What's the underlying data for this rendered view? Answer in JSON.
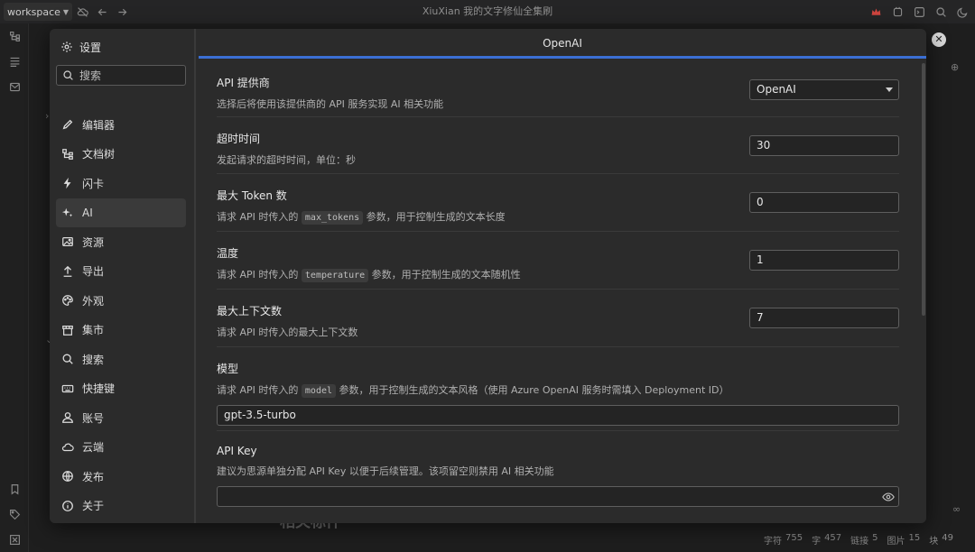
{
  "topbar": {
    "workspace_label": "workspace",
    "title": "XiuXian 我的文字修仙全集刷"
  },
  "background": {
    "heading": "相关标件",
    "status": [
      {
        "label": "字符",
        "value": "755"
      },
      {
        "label": "字",
        "value": "457"
      },
      {
        "label": "链接",
        "value": "5"
      },
      {
        "label": "图片",
        "value": "15"
      },
      {
        "label": "块",
        "value": "49"
      }
    ]
  },
  "dialog": {
    "title": "设置",
    "search_placeholder": "搜索",
    "nav": [
      {
        "label": "编辑器",
        "icon": "pencil-icon"
      },
      {
        "label": "文档树",
        "icon": "tree-icon"
      },
      {
        "label": "闪卡",
        "icon": "flash-icon"
      },
      {
        "label": "AI",
        "icon": "sparkle-icon",
        "active": true
      },
      {
        "label": "资源",
        "icon": "image-icon"
      },
      {
        "label": "导出",
        "icon": "export-icon"
      },
      {
        "label": "外观",
        "icon": "palette-icon"
      },
      {
        "label": "集市",
        "icon": "store-icon"
      },
      {
        "label": "搜索",
        "icon": "search-icon"
      },
      {
        "label": "快捷键",
        "icon": "keyboard-icon"
      },
      {
        "label": "账号",
        "icon": "user-icon"
      },
      {
        "label": "云端",
        "icon": "cloud-icon"
      },
      {
        "label": "发布",
        "icon": "globe-icon"
      },
      {
        "label": "关于",
        "icon": "info-icon"
      }
    ],
    "panel": {
      "title": "OpenAI",
      "provider": {
        "title": "API 提供商",
        "desc": "选择后将使用该提供商的 API 服务实现 AI 相关功能",
        "value": "OpenAI"
      },
      "timeout": {
        "title": "超时时间",
        "desc": "发起请求的超时时间，单位：秒",
        "value": "30"
      },
      "max_tokens": {
        "title": "最大 Token 数",
        "desc_pre": "请求 API 时传入的",
        "code": "max_tokens",
        "desc_post": "参数，用于控制生成的文本长度",
        "value": "0"
      },
      "temperature": {
        "title": "温度",
        "desc_pre": "请求 API 时传入的",
        "code": "temperature",
        "desc_post": "参数，用于控制生成的文本随机性",
        "value": "1"
      },
      "max_contexts": {
        "title": "最大上下文数",
        "desc": "请求 API 时传入的最大上下文数",
        "value": "7"
      },
      "model": {
        "title": "模型",
        "desc_pre": "请求 API 时传入的",
        "code": "model",
        "desc_post": "参数，用于控制生成的文本风格（使用 Azure OpenAI 服务时需填入 Deployment ID）",
        "value": "gpt-3.5-turbo"
      },
      "api_key": {
        "title": "API Key",
        "desc": "建议为思源单独分配 API Key 以便于后续管理。该项留空则禁用 AI 相关功能",
        "value": ""
      }
    }
  }
}
